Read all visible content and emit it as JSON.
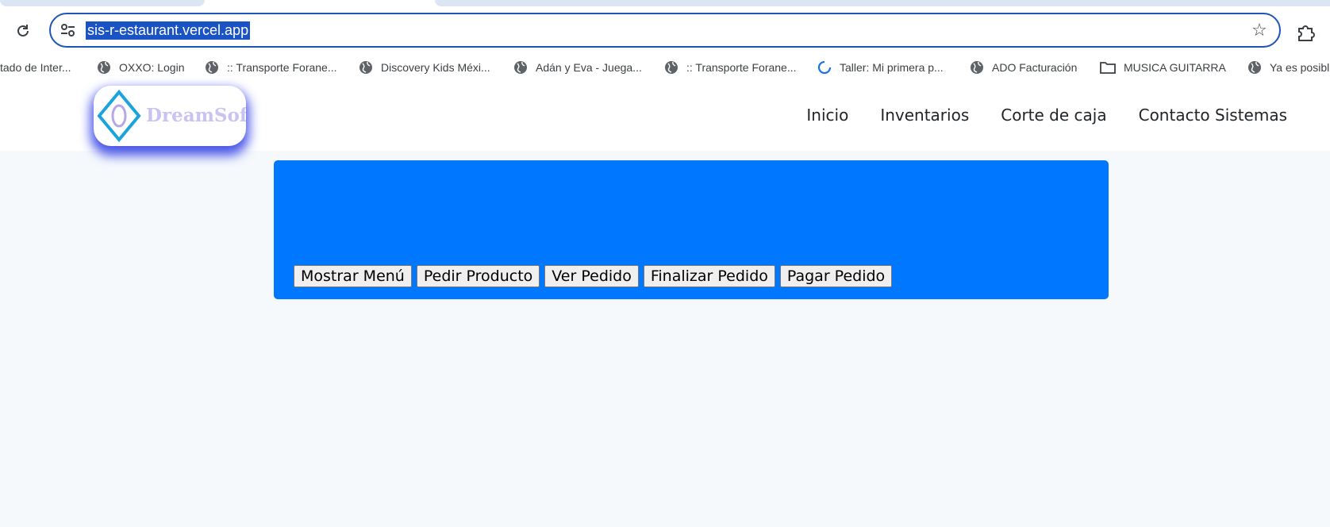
{
  "browser": {
    "url": "sis-r-estaurant.vercel.app",
    "bookmarks": [
      {
        "label": "tado de Inter...",
        "icon": "none"
      },
      {
        "label": "OXXO: Login",
        "icon": "globe-icon"
      },
      {
        "label": ":: Transporte Forane...",
        "icon": "globe-icon"
      },
      {
        "label": "Discovery Kids Méxi...",
        "icon": "globe-icon"
      },
      {
        "label": "Adán y Eva - Juega...",
        "icon": "globe-icon"
      },
      {
        "label": ":: Transporte Forane...",
        "icon": "globe-icon"
      },
      {
        "label": "Taller: Mi primera p...",
        "icon": "loading-icon"
      },
      {
        "label": "ADO Facturación",
        "icon": "globe-icon"
      },
      {
        "label": "MUSICA GUITARRA",
        "icon": "folder-icon"
      },
      {
        "label": "Ya es posibl",
        "icon": "globe-icon"
      }
    ]
  },
  "site": {
    "logo_text": "DreamSoft",
    "nav": [
      "Inicio",
      "Inventarios",
      "Corte de caja",
      "Contacto Sistemas"
    ]
  },
  "panel": {
    "color": "#0077ff",
    "buttons": [
      "Mostrar Menú",
      "Pedir Producto",
      "Ver Pedido",
      "Finalizar Pedido",
      "Pagar Pedido"
    ]
  }
}
